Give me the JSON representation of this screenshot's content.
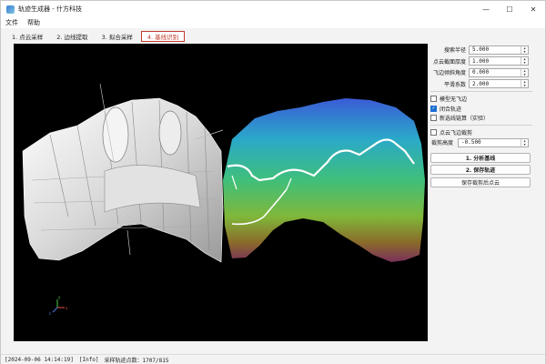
{
  "window": {
    "title": "轨迹生成器 - 什方科技",
    "minimize_glyph": "—",
    "maximize_glyph": "☐",
    "close_glyph": "✕"
  },
  "menu": {
    "items": [
      "文件",
      "帮助"
    ]
  },
  "tabs": [
    {
      "label": "1. 点云采样",
      "active": false
    },
    {
      "label": "2. 边线提取",
      "active": false
    },
    {
      "label": "3. 拟合采样",
      "active": false
    },
    {
      "label": "4. 基线识别",
      "active": true
    }
  ],
  "params": [
    {
      "label": "搜索半径",
      "value": "5.000"
    },
    {
      "label": "点云截面厚度",
      "value": "1.000"
    },
    {
      "label": "飞边倾斜角度",
      "value": "0.000"
    },
    {
      "label": "平滑系数",
      "value": "2.000"
    }
  ],
  "checks": [
    {
      "label": "模型无飞边",
      "checked": false
    },
    {
      "label": "闭合轨迹",
      "checked": true
    },
    {
      "label": "新选线链算（实验）",
      "checked": false
    }
  ],
  "crop": {
    "check_label": "点云飞边裁剪",
    "checked": false,
    "height_label": "裁剪高度",
    "height_value": "-0.500"
  },
  "buttons": {
    "analyze": "1. 分析基线",
    "save_track": "2. 保存轨迹",
    "save_cropped": "保存裁剪后点云"
  },
  "status": {
    "timestamp": "[2024-09-06 14:14:19]",
    "level": "[Info]",
    "message": "采样轨迹点数：1707/815"
  },
  "axes": {
    "x": "x",
    "y": "y",
    "z": "z"
  },
  "colors": {
    "active_tab": "#c0392b",
    "checkbox_accent": "#1c6fd1",
    "viewport_bg": "#000000"
  }
}
